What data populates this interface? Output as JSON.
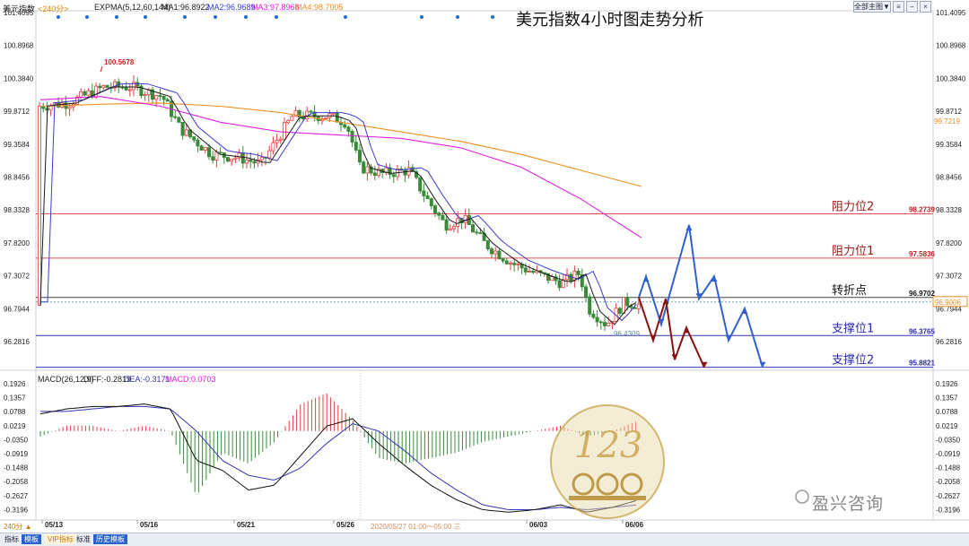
{
  "header": {
    "symbol": "美元指数",
    "period": "<240分>",
    "indicator": "EXPMA(5,12,60,144)",
    "ma1": "MA1:96.8922",
    "ma2": "MA2:96.9689",
    "ma3": "MA3:97.8968",
    "ma4": "MA4:98.7005",
    "title": "美元指数4小时图走势分析",
    "menu_label": "全部主图▼"
  },
  "colors": {
    "ma1": "#1a1a1a",
    "ma2": "#3b3bd0",
    "ma3": "#e020e0",
    "ma4": "#f09020",
    "up_candle": "#e04040",
    "down_candle": "#3a8a3a",
    "resistance": "#e05050",
    "pivot": "#444444",
    "support": "#3535b0",
    "forecast_up": "#3060d0",
    "forecast_down": "#8b1010"
  },
  "price_axis": [
    "101.4095",
    "100.8968",
    "100.3840",
    "99.8712",
    "99.3584",
    "98.8456",
    "98.3328",
    "97.8200",
    "97.3072",
    "96.7944",
    "96.2816"
  ],
  "macd_axis": [
    "0.1926",
    "0.1357",
    "0.0788",
    "0.0219",
    "-0.0350",
    "-0.0919",
    "-0.1488",
    "-0.2058",
    "-0.2627",
    "-0.3196"
  ],
  "macd_header": {
    "label": "MACD(26,12,9)",
    "diff": "DIFF:-0.2819",
    "dea": "DEA:-0.3171",
    "macd": "MACD:0.0703"
  },
  "annotations": {
    "high_price": "100.5678",
    "low_price": "96.4309",
    "ma4_value": "99.7219",
    "current_price": "96.9006"
  },
  "levels": [
    {
      "label": "阻力位2",
      "value": "98.2739",
      "price": 98.2739,
      "kind": "resistance"
    },
    {
      "label": "阻力位1",
      "value": "97.5836",
      "price": 97.5836,
      "kind": "resistance"
    },
    {
      "label": "转折点",
      "value": "96.9702",
      "price": 96.9702,
      "kind": "pivot"
    },
    {
      "label": "支撑位1",
      "value": "96.3765",
      "price": 96.3765,
      "kind": "support"
    },
    {
      "label": "支撑位2",
      "value": "95.8821",
      "price": 95.8821,
      "kind": "support"
    }
  ],
  "x_axis": {
    "dates": [
      "05/13",
      "05/16",
      "05/21",
      "05/26",
      "06/03",
      "06/06"
    ],
    "cursor_time": "2020/05/27 01:00～05:00 三"
  },
  "bottom_tabs": [
    "指标",
    "模板",
    "VIP指标",
    "标准",
    "历史模板"
  ],
  "bottom_period": "240分 ▲",
  "watermark": "盈兴咨询",
  "chart_data": [
    {
      "type": "line",
      "title": "美元指数4小时图走势分析",
      "ylim": [
        96.1,
        101.6
      ],
      "series": [
        {
          "name": "MA4",
          "values": [
            99.95,
            99.98,
            100.0,
            99.95,
            99.85,
            99.7,
            99.55,
            99.4,
            99.2,
            98.95,
            98.7
          ]
        },
        {
          "name": "MA3",
          "values": [
            100.05,
            100.1,
            99.95,
            99.7,
            99.55,
            99.5,
            99.45,
            99.3,
            99.0,
            98.5,
            97.9
          ]
        }
      ],
      "forecast_blue": [
        96.97,
        97.3,
        96.55,
        98.1,
        96.95,
        97.3,
        96.3,
        96.8,
        95.88
      ],
      "forecast_red": [
        96.97,
        96.3,
        96.95,
        96.0,
        96.5,
        95.88
      ]
    },
    {
      "type": "bar",
      "title": "MACD(26,12,9)",
      "ylim": [
        -0.34,
        0.21
      ],
      "diff_values": [
        0.07,
        0.09,
        0.1,
        0.1,
        0.11,
        0.09,
        -0.12,
        -0.16,
        -0.24,
        -0.22,
        -0.1,
        0.02,
        0.05,
        -0.05,
        -0.14,
        -0.22,
        -0.28,
        -0.32,
        -0.33,
        -0.32,
        -0.3,
        -0.33,
        -0.31,
        -0.28
      ],
      "dea_values": [
        0.08,
        0.08,
        0.09,
        0.1,
        0.1,
        0.09,
        0.0,
        -0.12,
        -0.18,
        -0.2,
        -0.15,
        -0.05,
        0.03,
        0.0,
        -0.08,
        -0.17,
        -0.24,
        -0.3,
        -0.32,
        -0.32,
        -0.31,
        -0.32,
        -0.31,
        -0.3
      ]
    }
  ]
}
